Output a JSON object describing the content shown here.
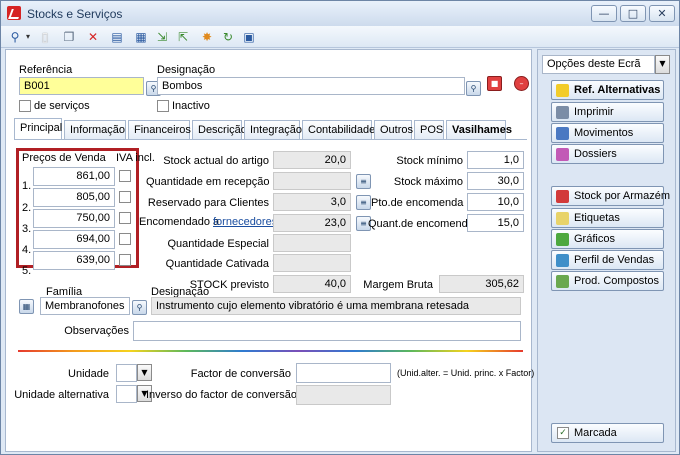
{
  "window": {
    "title": "Stocks e Serviços",
    "minimize": "—",
    "maximize": "□",
    "close": "✕"
  },
  "toolbar": {
    "icons": [
      "search-icon",
      "new-document-icon",
      "copy-icon",
      "delete-icon",
      "properties-icon",
      "table-icon",
      "export-icon",
      "import-icon",
      "wizard-icon",
      "refresh-icon",
      "save-icon"
    ]
  },
  "header": {
    "referencia_label": "Referência",
    "referencia_value": "B001",
    "designacao_label": "Designação",
    "designacao_value": "Bombos",
    "servicos_label": "de serviços",
    "inactivo_label": "Inactivo"
  },
  "tabs": [
    "Principal",
    "Informação",
    "Financeiros",
    "Descrição",
    "Integração",
    "Contabilidade",
    "Outros",
    "POS",
    "Vasilhames"
  ],
  "prices": {
    "header": "Preços de Venda",
    "iva_header": "IVA incl.",
    "rows": [
      {
        "num": "1.",
        "value": "861,00"
      },
      {
        "num": "2.",
        "value": "805,00"
      },
      {
        "num": "3.",
        "value": "750,00"
      },
      {
        "num": "4.",
        "value": "694,00"
      },
      {
        "num": "5.",
        "value": "639,00"
      }
    ]
  },
  "stock": {
    "actual_label": "Stock actual do artigo",
    "actual_value": "20,0",
    "recepcao_label": "Quantidade em recepção",
    "recepcao_value": "",
    "reservado_label": "Reservado para Clientes",
    "reservado_value": "3,0",
    "encomendado_label": "Encomendado a",
    "encomendado_link": "fornecedores",
    "encomendado_value": "23,0",
    "especial_label": "Quantidade Especial",
    "especial_value": "",
    "cativada_label": "Quantidade Cativada",
    "cativada_value": "",
    "previsto_label": "STOCK previsto",
    "previsto_value": "40,0",
    "minimo_label": "Stock mínimo",
    "minimo_value": "1,0",
    "maximo_label": "Stock máximo",
    "maximo_value": "30,0",
    "pto_label": "Pto.de encomenda",
    "pto_value": "10,0",
    "quant_label": "Quant.de encomenda",
    "quant_value": "15,0",
    "margem_label": "Margem Bruta",
    "margem_value": "305,62"
  },
  "family": {
    "familia_label": "Família",
    "familia_value": "Membranofones",
    "designacao_label": "Designação",
    "designacao_value": "Instrumento cujo elemento vibratório é uma membrana retesada",
    "observacoes_label": "Observações"
  },
  "units": {
    "unidade_label": "Unidade",
    "alternativa_label": "Unidade alternativa",
    "factor_label": "Factor de conversão",
    "inverso_label": "Inverso do factor de conversão",
    "formula": "(Unid.alter. = Unid. princ. x Factor)"
  },
  "sidebar": {
    "options_label": "Opções deste Ecrã",
    "buttons": [
      "Ref. Alternativas",
      "Imprimir",
      "Movimentos",
      "Dossiers",
      "Stock por Armazém",
      "Etiquetas",
      "Gráficos",
      "Perfil de Vendas",
      "Prod. Compostos"
    ],
    "marcada_label": "Marcada"
  },
  "colors": {
    "highlight_border": "#b01f24",
    "ref_field": "#ffff99",
    "accent": "#1b4ea0"
  }
}
